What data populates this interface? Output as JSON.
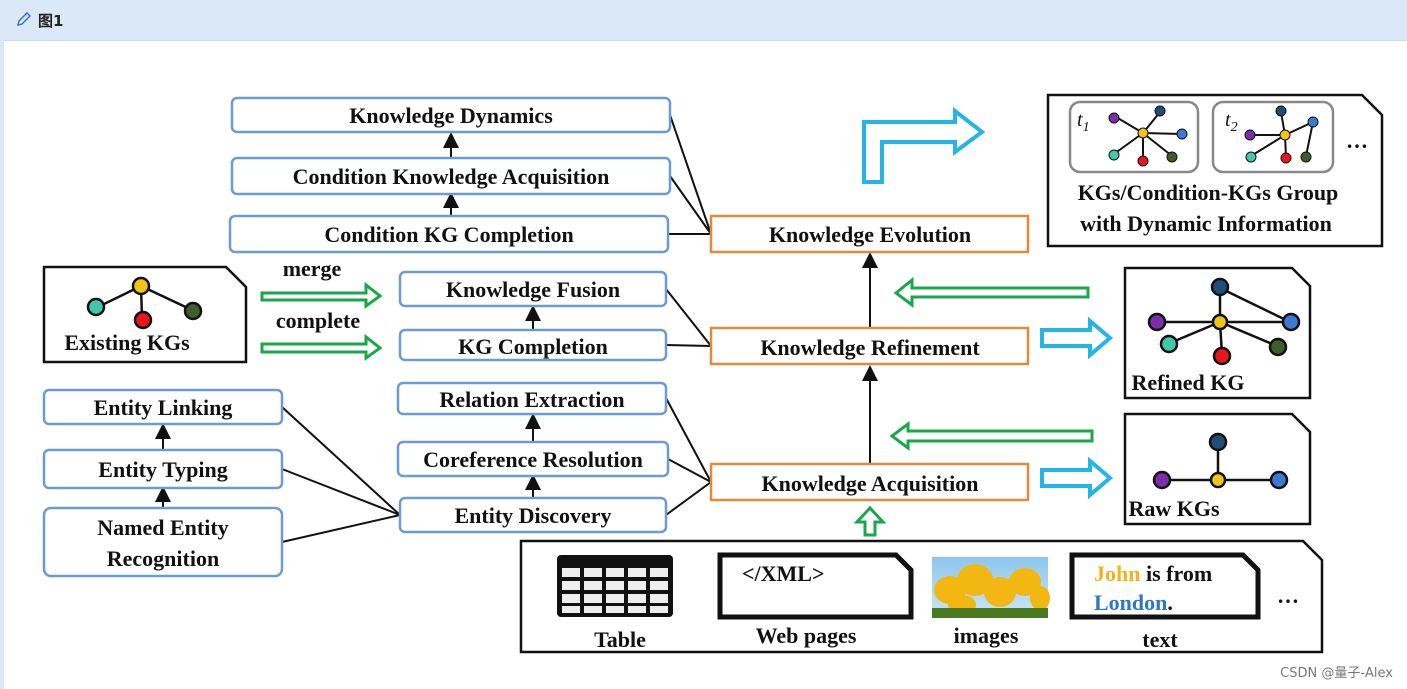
{
  "window": {
    "title": "图1",
    "watermark": "CSDN @量子-Alex"
  },
  "colors": {
    "blue_box": "#6a9bd1",
    "orange_box": "#e0893f",
    "green_arrow": "#1aa64a",
    "cyan_arrow": "#25b4e8",
    "header_bg": "#dae8f8"
  },
  "left_column": {
    "entity_linking": "Entity Linking",
    "entity_typing": "Entity Typing",
    "ner_line1": "Named Entity",
    "ner_line2": "Recognition",
    "existing_kgs": "Existing KGs",
    "merge": "merge",
    "complete": "complete"
  },
  "middle_column": {
    "knowledge_dynamics": "Knowledge Dynamics",
    "condition_knowledge_acquisition": "Condition Knowledge Acquisition",
    "condition_kg_completion": "Condition KG Completion",
    "knowledge_fusion": "Knowledge Fusion",
    "kg_completion": "KG Completion",
    "relation_extraction": "Relation Extraction",
    "coreference_resolution": "Coreference Resolution",
    "entity_discovery": "Entity Discovery"
  },
  "main_stages": {
    "knowledge_evolution": "Knowledge Evolution",
    "knowledge_refinement": "Knowledge Refinement",
    "knowledge_acquisition": "Knowledge Acquisition"
  },
  "outputs": {
    "t1": "t",
    "t1_sub": "1",
    "t2": "t",
    "t2_sub": "2",
    "ellipsis": "…",
    "group_line1": "KGs/Condition-KGs Group",
    "group_line2": "with Dynamic Information",
    "refined_kg": "Refined KG",
    "raw_kgs": "Raw KGs"
  },
  "sources": {
    "table": "Table",
    "web_pages": "Web pages",
    "xml": "</XML>",
    "images": "images",
    "text": "text",
    "text_john": "John",
    "text_is_from": " is from",
    "text_london": "London",
    "text_period": ".",
    "ellipsis": "…"
  }
}
